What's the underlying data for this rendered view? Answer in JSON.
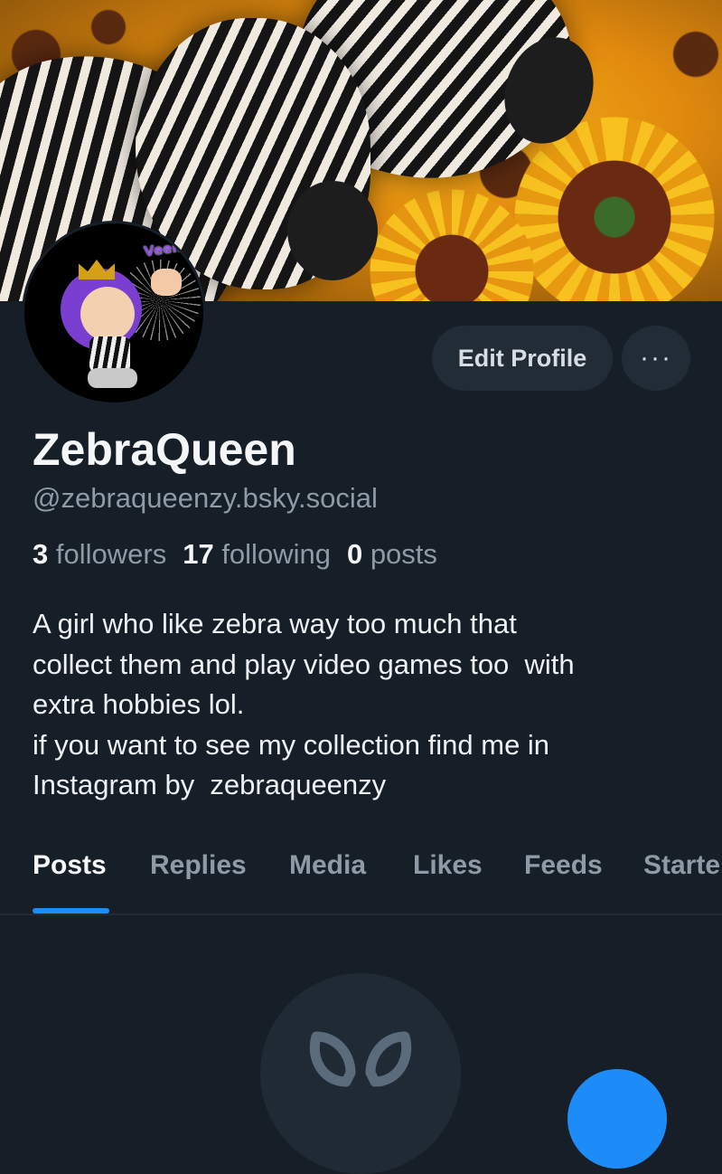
{
  "profile": {
    "display_name": "ZebraQueen",
    "handle": "@zebraqueenzy.bsky.social",
    "followers_count": "3",
    "followers_label": "followers",
    "following_count": "17",
    "following_label": "following",
    "posts_count": "0",
    "posts_label": "posts",
    "bio_lines": [
      "A girl who like zebra way too much that",
      "collect them and play video games too  with",
      "extra hobbies lol.",
      "if you want to see my collection find me in",
      "Instagram by  zebraqueenzy"
    ],
    "avatar_text": "Veemo!"
  },
  "actions": {
    "edit_profile": "Edit Profile",
    "more": "···"
  },
  "tabs": [
    {
      "label": "Posts",
      "active": true
    },
    {
      "label": "Replies",
      "active": false
    },
    {
      "label": "Media",
      "active": false
    },
    {
      "label": "Likes",
      "active": false
    },
    {
      "label": "Feeds",
      "active": false
    },
    {
      "label": "Starte",
      "active": false
    }
  ],
  "colors": {
    "background": "#161e27",
    "accent": "#1d8cf8",
    "muted_text": "#8e9aa6",
    "button_bg": "#222c37"
  },
  "icons": {
    "empty_state": "butterfly-icon",
    "more": "ellipsis-icon"
  }
}
